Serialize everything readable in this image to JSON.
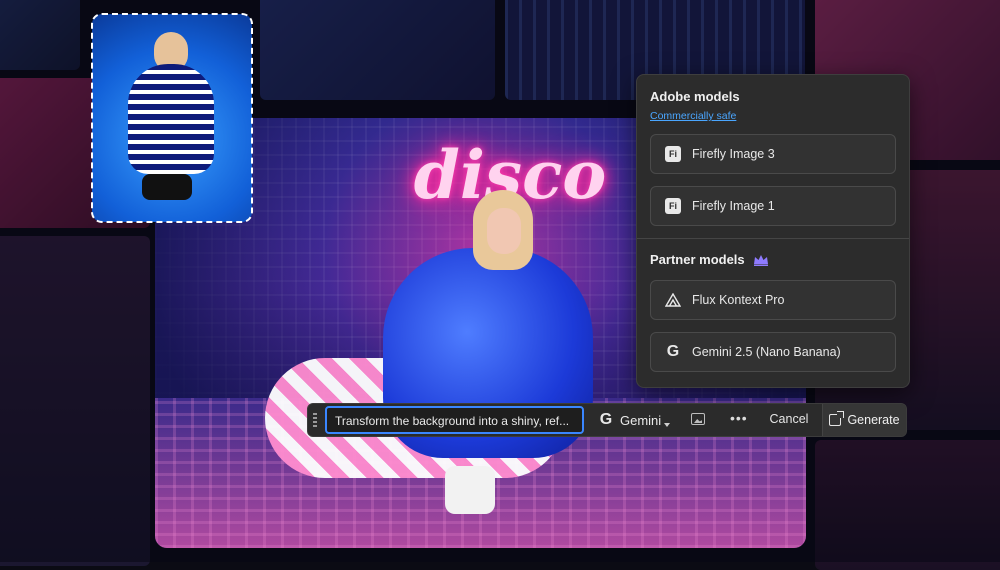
{
  "canvas": {
    "neon_text": "disco"
  },
  "model_panel": {
    "adobe_title": "Adobe models",
    "adobe_link": "Commercially safe",
    "adobe_models": [
      {
        "label": "Firefly Image 3",
        "icon": "Fi"
      },
      {
        "label": "Firefly Image 1",
        "icon": "Fi"
      }
    ],
    "partner_title": "Partner models",
    "partner_models": [
      {
        "label": "Flux Kontext Pro",
        "icon": "flux-icon"
      },
      {
        "label": "Gemini 2.5 (Nano Banana)",
        "icon": "G"
      }
    ]
  },
  "prompt_bar": {
    "prompt_text": "Transform the background into a shiny, ref...",
    "model_glyph": "G",
    "model_label": "Gemini",
    "more_label": "•••",
    "cancel_label": "Cancel",
    "generate_label": "Generate"
  },
  "colors": {
    "accent": "#3a86ff",
    "link": "#4aa6ff",
    "premium": "#8f7bff",
    "neon": "#ff2a9d"
  }
}
